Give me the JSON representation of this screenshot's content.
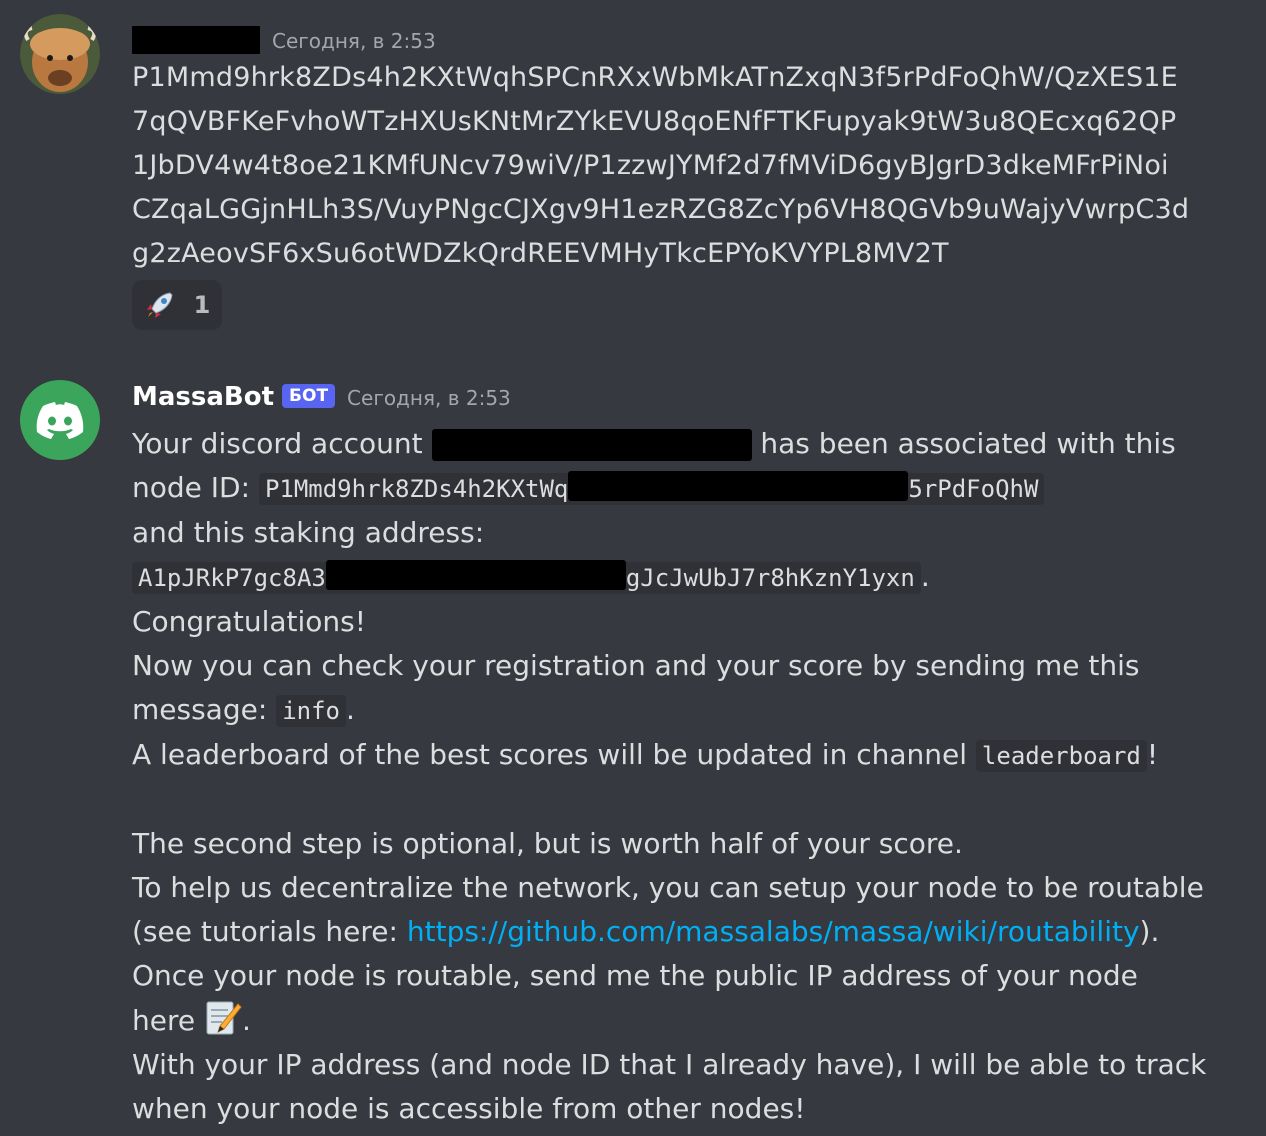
{
  "message1": {
    "timestamp": "Сегодня, в 2:53",
    "text_lines": [
      "P1Mmd9hrk8ZDs4h2KXtWqhSPCnRXxWbMkATnZxqN3f5rPdFoQhW/QzXES1E",
      "7qQVBFKeFvhoWTzHXUsKNtMrZYkEVU8qoENfFTKFupyak9tW3u8QEcxq62QP",
      "1JbDV4w4t8oe21KMfUNcv79wiV/P1zzwJYMf2d7fMViD6gyBJgrD3dkeMFrPiNoi",
      "CZqaLGGjnHLh3S/VuyPNgcCJXgv9H1ezRZG8ZcYp6VH8QGVb9uWajyVwrpC3d",
      "g2zAeovSF6xSu6otWDZkQrdREEVMHyTkcEPYoKVYPL8MV2T"
    ],
    "reaction": {
      "icon": "rocket-icon",
      "count": "1"
    }
  },
  "message2": {
    "username": "MassaBot",
    "bot_tag": "БОТ",
    "timestamp": "Сегодня, в 2:53",
    "l1_a": "Your discord account",
    "l1_b": "has been associated with this",
    "l2_a": "node ID:",
    "node_id_start": "P1Mmd9hrk8ZDs4h2KXtWq",
    "node_id_end": "5rPdFoQhW",
    "l3": "and this staking address:",
    "addr_start": "A1pJRkP7gc8A3",
    "addr_end": "gJcJwUbJ7r8hKznY1yxn",
    "addr_period": ".",
    "l5": "Congratulations!",
    "l6": "Now you can check your registration and your score by sending me this",
    "l7_a": "message:",
    "l7_code": "info",
    "l7_b": ".",
    "l8_a": "A leaderboard of the best scores will be updated in channel",
    "l8_code": "leaderboard",
    "l8_b": "!",
    "l9": "The second step is optional, but is worth half of your score.",
    "l10": "To help us decentralize the network, you can setup your node to be routable",
    "l11_a": "(see tutorials here:",
    "l11_link": "https://github.com/massalabs/massa/wiki/routability",
    "l11_b": ").",
    "l12": "Once your node is routable, send me the public IP address of your node",
    "l13_a": "here",
    "l13_b": ".",
    "l14": "With your IP address (and node ID that I already have), I will be able to track",
    "l15": "when your node is accessible from other nodes!"
  }
}
